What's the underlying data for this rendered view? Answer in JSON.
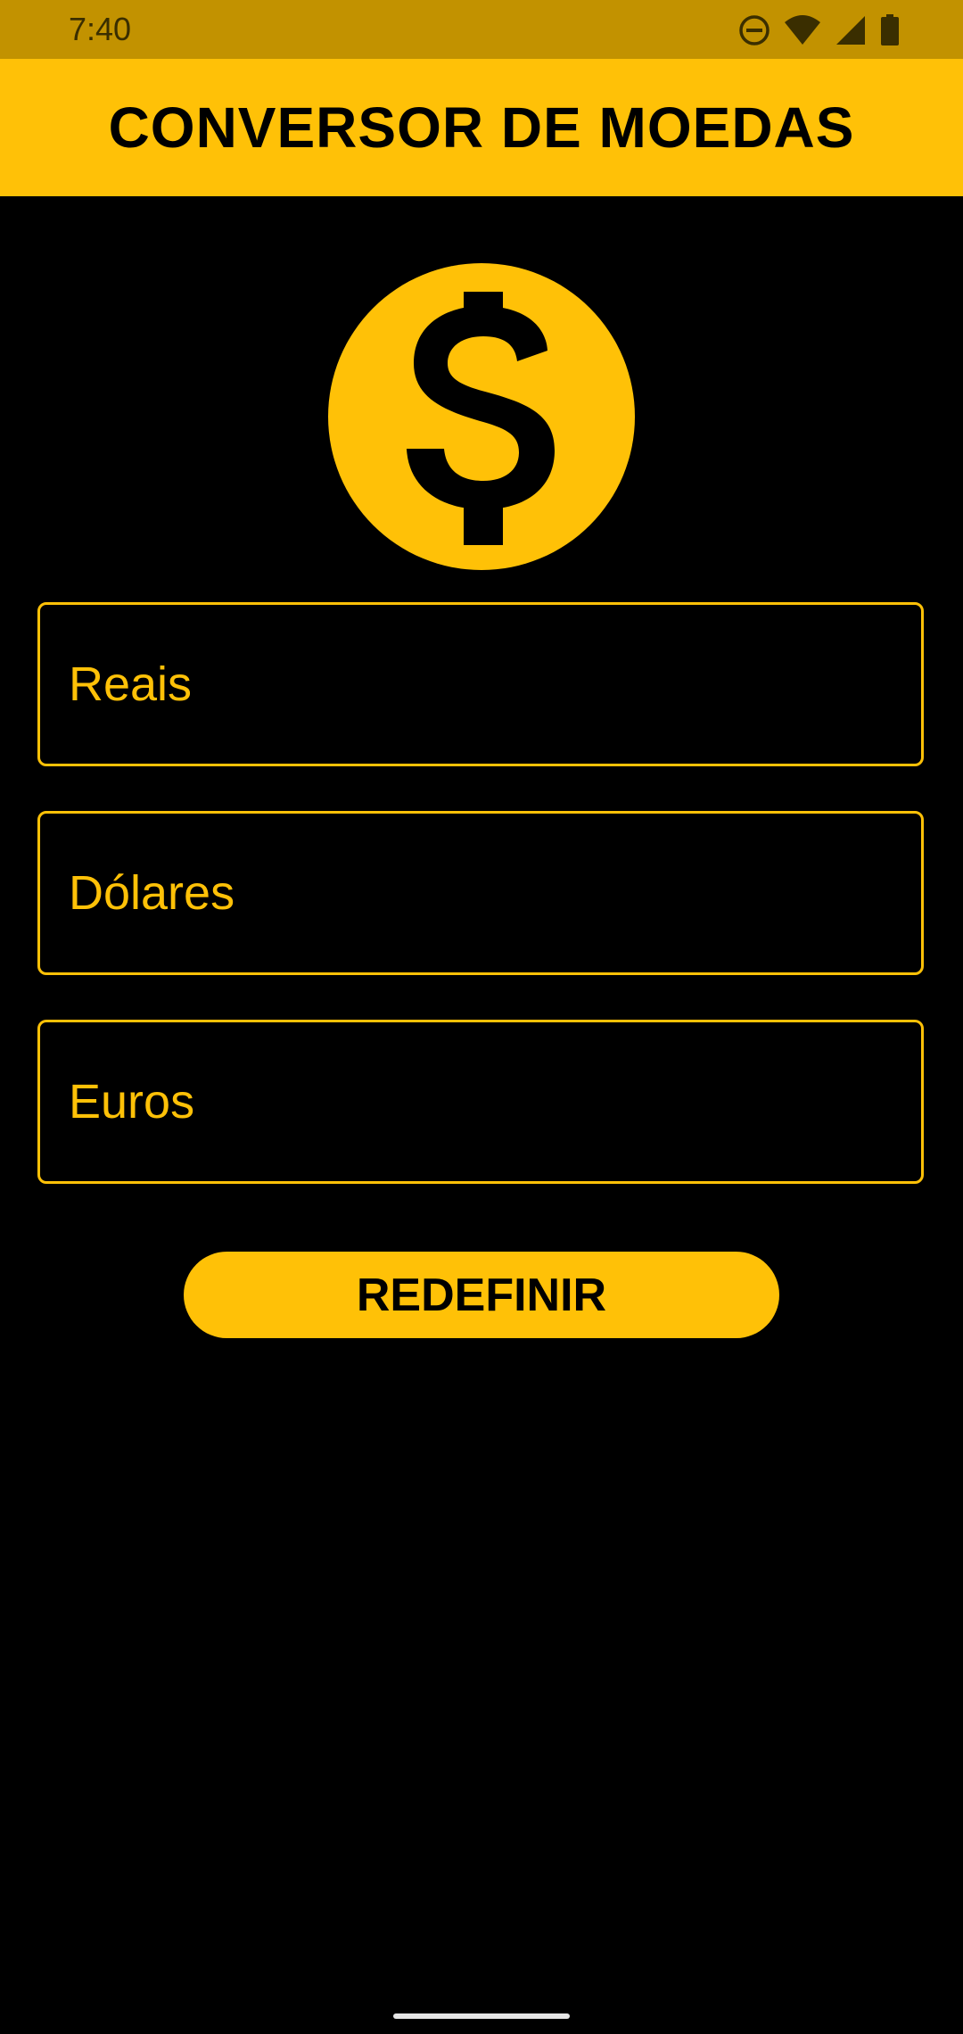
{
  "status_bar": {
    "time": "7:40",
    "icons": [
      "do-not-disturb-icon",
      "wifi-icon",
      "cell-signal-icon",
      "battery-icon"
    ],
    "background": "#C29200"
  },
  "app_bar": {
    "title": "CONVERSOR DE MOEDAS",
    "background": "#FFC107"
  },
  "logo": {
    "icon": "dollar-coin-icon",
    "color": "#FFC107"
  },
  "fields": {
    "reais": {
      "placeholder": "Reais",
      "value": ""
    },
    "dolares": {
      "placeholder": "Dólares",
      "value": ""
    },
    "euros": {
      "placeholder": "Euros",
      "value": ""
    }
  },
  "actions": {
    "reset_label": "REDEFINIR"
  },
  "colors": {
    "accent": "#FFC107",
    "background": "#000000",
    "text_on_accent": "#000000"
  }
}
